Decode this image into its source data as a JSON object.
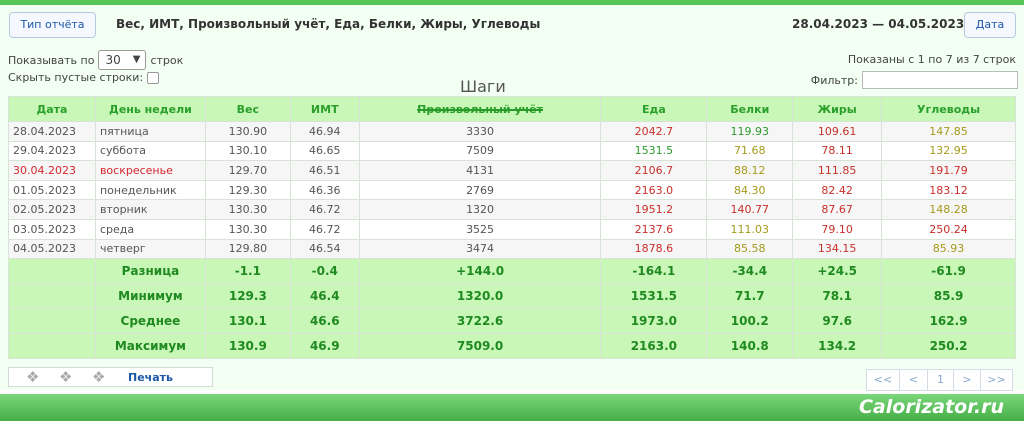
{
  "header": {
    "report_type_btn": "Тип отчёта",
    "title": "Вес, ИМТ, Произвольный учёт, Еда, Белки, Жиры, Углеводы",
    "date_range": "28.04.2023 — 04.05.2023",
    "date_btn": "Дата"
  },
  "controls": {
    "show_prefix": "Показывать по",
    "show_value": "30",
    "show_suffix": "строк",
    "hide_empty_label": "Скрыть пустые строки:",
    "shown_info": "Показаны с 1 по 7 из 7 строк",
    "filter_label": "Фильтр:",
    "filter_value": ""
  },
  "chart_tag": "Шаги",
  "table": {
    "columns": [
      "Дата",
      "День недели",
      "Вес",
      "ИМТ",
      "Произвольный учёт",
      "Еда",
      "Белки",
      "Жиры",
      "Углеводы"
    ],
    "rows": [
      [
        "28.04.2023",
        "пятница",
        "130.90",
        "46.94",
        "3330",
        "2042.7",
        "119.93",
        "109.61",
        "147.85"
      ],
      [
        "29.04.2023",
        "суббота",
        "130.10",
        "46.65",
        "7509",
        "1531.5",
        "71.68",
        "78.11",
        "132.95"
      ],
      [
        "30.04.2023",
        "воскресенье",
        "129.70",
        "46.51",
        "4131",
        "2106.7",
        "88.12",
        "111.85",
        "191.79"
      ],
      [
        "01.05.2023",
        "понедельник",
        "129.30",
        "46.36",
        "2769",
        "2163.0",
        "84.30",
        "82.42",
        "183.12"
      ],
      [
        "02.05.2023",
        "вторник",
        "130.30",
        "46.72",
        "1320",
        "1951.2",
        "140.77",
        "87.67",
        "148.28"
      ],
      [
        "03.05.2023",
        "среда",
        "130.30",
        "46.72",
        "3525",
        "2137.6",
        "111.03",
        "79.10",
        "250.24"
      ],
      [
        "04.05.2023",
        "четверг",
        "129.80",
        "46.54",
        "3474",
        "1878.6",
        "85.58",
        "134.15",
        "85.93"
      ]
    ],
    "summary": [
      [
        "Разница",
        "-1.1",
        "-0.4",
        "+144.0",
        "-164.1",
        "-34.4",
        "+24.5",
        "-61.9"
      ],
      [
        "Минимум",
        "129.3",
        "46.4",
        "1320.0",
        "1531.5",
        "71.7",
        "78.1",
        "85.9"
      ],
      [
        "Среднее",
        "130.1",
        "46.6",
        "3722.6",
        "1973.0",
        "100.2",
        "97.6",
        "162.9"
      ],
      [
        "Максимум",
        "130.9",
        "46.9",
        "7509.0",
        "2163.0",
        "140.8",
        "134.2",
        "250.2"
      ]
    ]
  },
  "toolbar": {
    "print": "Печать"
  },
  "pager": {
    "first": "<<",
    "prev": "<",
    "page": "1",
    "next": ">",
    "last": ">>"
  },
  "brand": "Calorizator.ru",
  "colors": {
    "accent": "#58c558",
    "header_bg": "#c8f7b8",
    "header_text": "#2aa02a",
    "over": "#c8302a",
    "under": "#2c9a2c",
    "normal": "#a49a1c"
  },
  "cell_colors": {
    "food": [
      "red",
      "green",
      "red",
      "red",
      "red",
      "red",
      "red"
    ],
    "protein": [
      "green",
      "olive",
      "olive",
      "olive",
      "red",
      "olive",
      "olive"
    ],
    "fat": [
      "red",
      "red",
      "red",
      "red",
      "red",
      "red",
      "red"
    ],
    "carbs": [
      "olive",
      "olive",
      "red",
      "red",
      "olive",
      "red",
      "olive"
    ]
  }
}
